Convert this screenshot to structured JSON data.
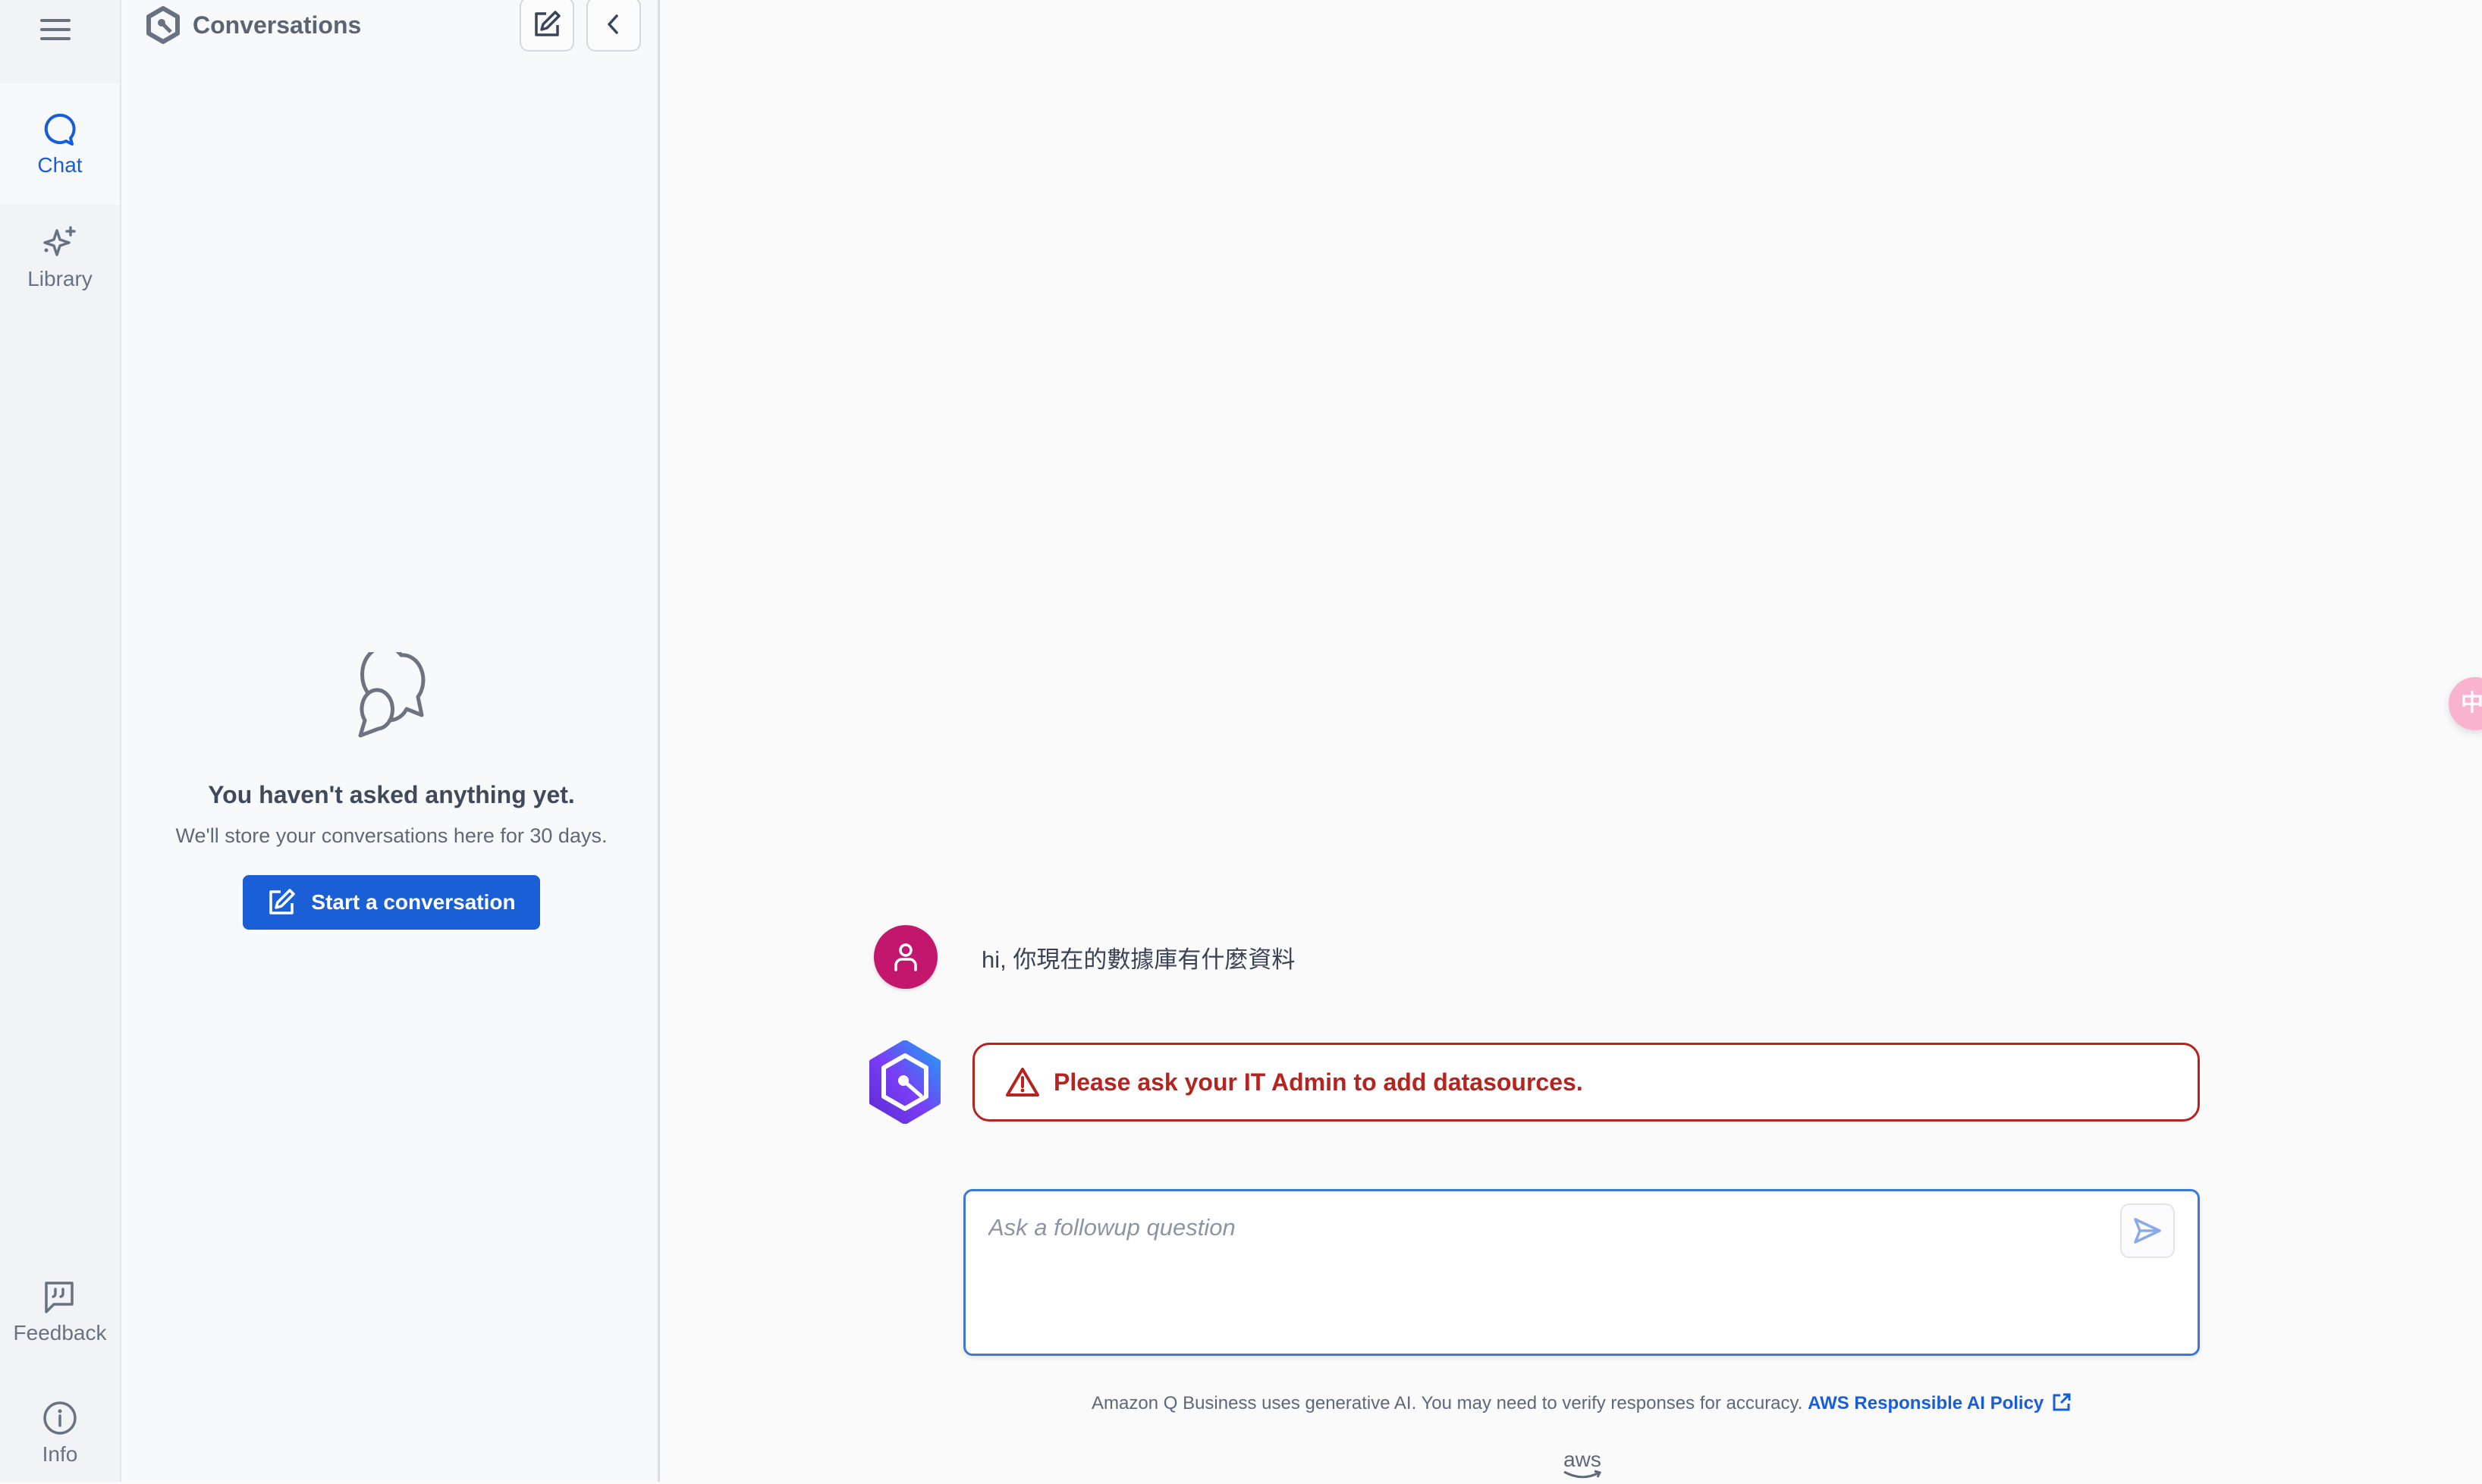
{
  "rail": {
    "menu_icon": "hamburger-menu-icon",
    "items": [
      {
        "label": "Chat",
        "icon": "chat-bubble-icon",
        "active": true
      },
      {
        "label": "Library",
        "icon": "sparkles-icon",
        "active": false
      },
      {
        "label": "Feedback",
        "icon": "quote-bubble-icon",
        "active": false
      },
      {
        "label": "Info",
        "icon": "info-circle-icon",
        "active": false
      }
    ]
  },
  "panel": {
    "title": "Conversations",
    "new_chat_icon": "edit-icon",
    "collapse_icon": "chevron-left-icon",
    "empty_state": {
      "icon": "chat-bubbles-icon",
      "heading": "You haven't asked anything yet.",
      "subtext": "We'll store your conversations here for 30 days.",
      "button_label": "Start a conversation"
    }
  },
  "chat": {
    "messages": [
      {
        "role": "user",
        "text": "hi, 你現在的數據庫有什麼資料"
      },
      {
        "role": "assistant",
        "type": "error",
        "text": "Please ask your IT Admin to add datasources."
      }
    ],
    "input": {
      "placeholder": "Ask a followup question",
      "value": ""
    },
    "footer_text": "Amazon Q Business uses generative AI. You may need to verify responses for accuracy.",
    "footer_link": "AWS Responsible AI Policy",
    "brand_logo": "aws"
  },
  "floating_badge": {
    "label": "中"
  },
  "colors": {
    "accent": "#175fd8",
    "error": "#b5241f",
    "user_avatar": "#c3176d",
    "input_border": "#3d7ad6"
  }
}
